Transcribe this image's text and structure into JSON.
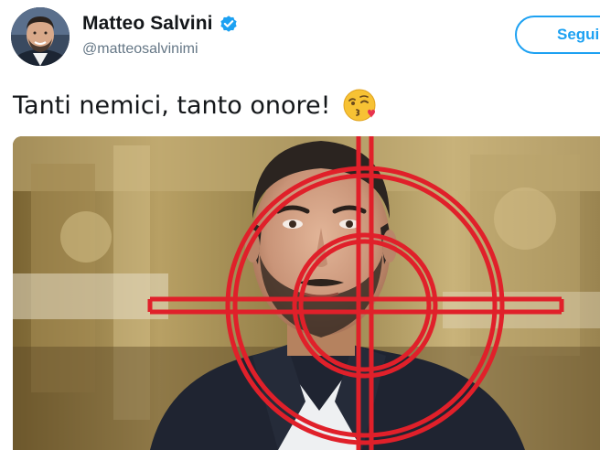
{
  "author": {
    "display_name": "Matteo Salvini",
    "handle": "@matteosalvinimi",
    "verified": true,
    "avatar_icon": "profile-photo"
  },
  "follow_button": {
    "label": "Segui"
  },
  "tweet": {
    "text": "Tanti nemici, tanto onore!",
    "emoji": "face-blowing-a-kiss-emoji"
  },
  "media": {
    "description_icon": "photo-with-red-crosshair"
  },
  "colors": {
    "twitter_blue": "#1da1f2",
    "name_text": "#14171a",
    "handle_text": "#657786",
    "crosshair_red": "#e0202a"
  }
}
